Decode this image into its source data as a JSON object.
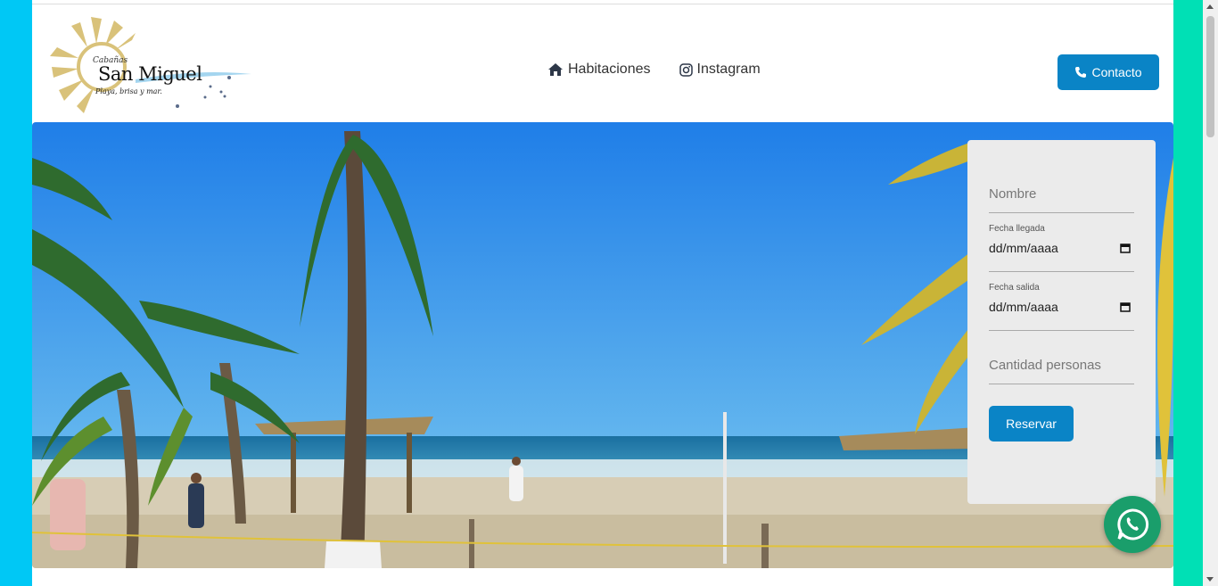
{
  "header": {
    "logo": {
      "small_text": "Cabañas",
      "brand": "San Miguel",
      "tagline": "Playa, brisa y mar."
    },
    "nav": [
      {
        "label": "Habitaciones",
        "icon": "home-icon"
      },
      {
        "label": "Instagram",
        "icon": "instagram-icon"
      }
    ],
    "contact_label": "Contacto"
  },
  "form": {
    "name_placeholder": "Nombre",
    "arrival_label": "Fecha llegada",
    "arrival_value": "dd/mm/aaaa",
    "departure_label": "Fecha salida",
    "departure_value": "dd/mm/aaaa",
    "people_placeholder": "Cantidad personas",
    "submit_label": "Reservar"
  },
  "colors": {
    "accent": "#0a84c6",
    "left_bg": "#00c8f5",
    "right_bg": "#00e0b5",
    "whatsapp": "#1a9e6b"
  }
}
